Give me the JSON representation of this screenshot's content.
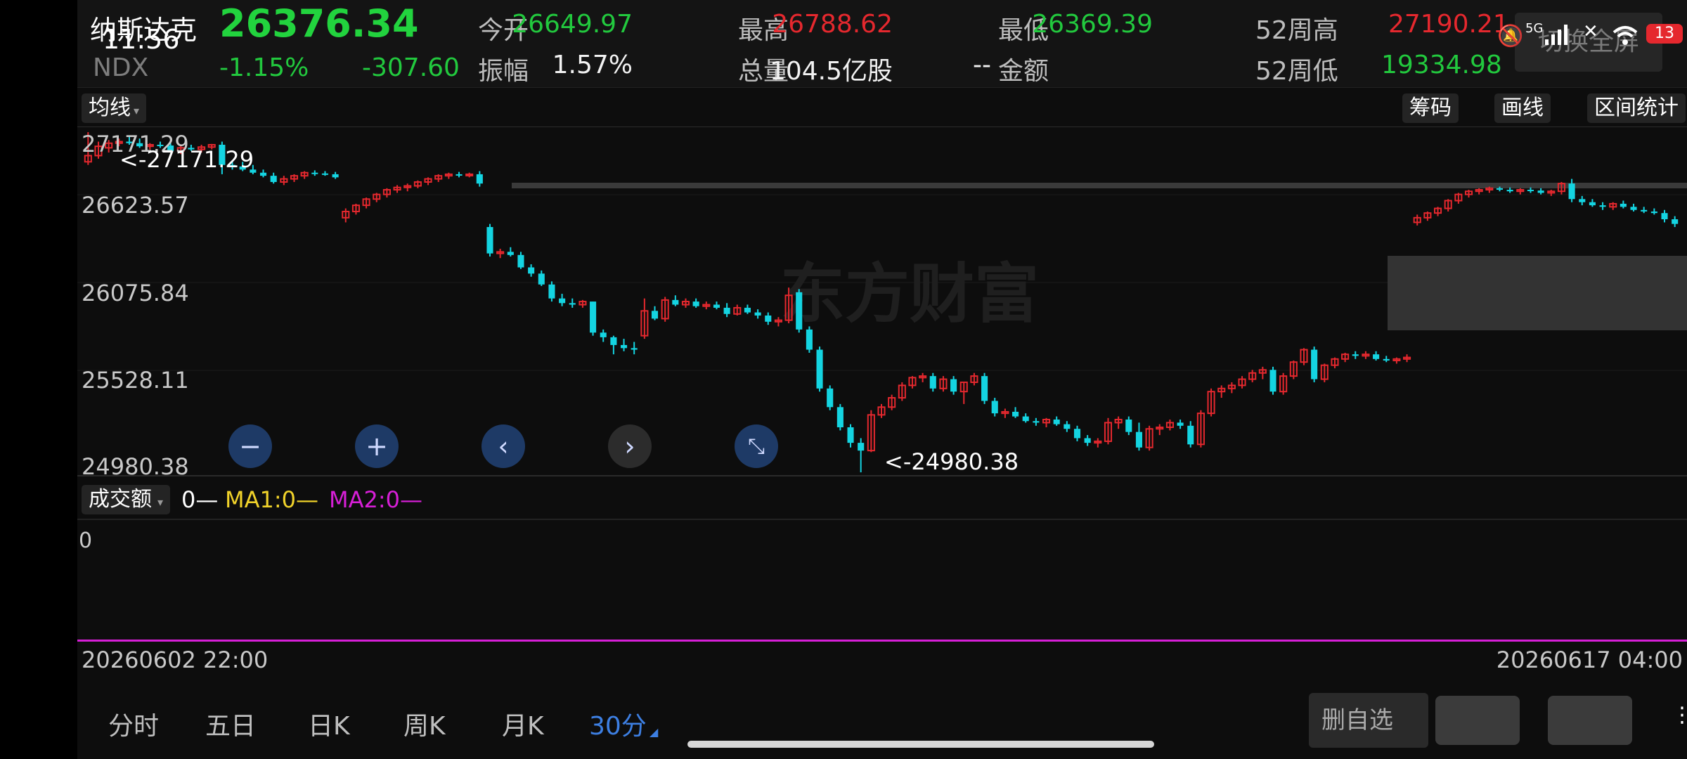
{
  "status": {
    "time": "11:56",
    "net": "5G",
    "battery": "13"
  },
  "quote": {
    "name": "纳斯达克",
    "code": "NDX",
    "price": "26376.34",
    "change_pct": "-1.15%",
    "change": "-307.60",
    "fields": [
      {
        "label": "今开",
        "value": "26649.97",
        "color": "green"
      },
      {
        "label": "最高",
        "value": "26788.62",
        "color": "red"
      },
      {
        "label": "最低",
        "value": "26369.39",
        "color": "green"
      },
      {
        "label": "52周高",
        "value": "27190.21",
        "color": "red"
      },
      {
        "label": "振幅",
        "value": "1.57%",
        "color": "white"
      },
      {
        "label": "总量",
        "value": "104.5亿股",
        "color": "white"
      },
      {
        "label": "金额",
        "value": "--",
        "color": "white"
      },
      {
        "label": "52周低",
        "value": "19334.98",
        "color": "green"
      }
    ],
    "fullscreen_label": "切换全屏"
  },
  "toolbar": {
    "ma_label": "均线",
    "chip_label": "筹码",
    "draw_label": "画线",
    "range_label": "区间统计"
  },
  "price_axis": [
    "27171.29",
    "26623.57",
    "26075.84",
    "25528.11",
    "24980.38"
  ],
  "annotations": {
    "high": "<-27171.29",
    "low": "<-24980.38"
  },
  "watermark": "东方财富",
  "volume": {
    "selector": "成交额",
    "v0": "0—",
    "ma1": "MA1:0—",
    "ma2": "MA2:0—",
    "axis_zero": "0"
  },
  "time_axis": {
    "start": "20260602 22:00",
    "end": "20260617 04:00"
  },
  "tabs": [
    "分时",
    "五日",
    "日K",
    "周K",
    "月K",
    "30分"
  ],
  "active_tab": "30分",
  "delete_label": "删自选",
  "colors": {
    "up": "#e5282e",
    "down": "#14d4e1",
    "ma2": "#d61fd6",
    "ma1": "#f0d22a"
  },
  "chart_data": {
    "type": "candlestick",
    "ylim": [
      24980.38,
      27171.29
    ],
    "x_start": "20260602 22:00",
    "x_end": "20260617 04:00",
    "candles": [
      {
        "o": 26980,
        "h": 27171,
        "l": 26960,
        "c": 27020
      },
      {
        "o": 27020,
        "h": 27110,
        "l": 27000,
        "c": 27080
      },
      {
        "o": 27070,
        "h": 27120,
        "l": 27040,
        "c": 27100
      },
      {
        "o": 27100,
        "h": 27130,
        "l": 27080,
        "c": 27110
      },
      {
        "o": 27110,
        "h": 27140,
        "l": 27090,
        "c": 27100
      },
      {
        "o": 27100,
        "h": 27130,
        "l": 27070,
        "c": 27080
      },
      {
        "o": 27080,
        "h": 27100,
        "l": 27060,
        "c": 27090
      },
      {
        "o": 27090,
        "h": 27110,
        "l": 27070,
        "c": 27085
      },
      {
        "o": 27085,
        "h": 27100,
        "l": 27040,
        "c": 27050
      },
      {
        "o": 27050,
        "h": 27090,
        "l": 27030,
        "c": 27070
      },
      {
        "o": 27070,
        "h": 27090,
        "l": 27050,
        "c": 27060
      },
      {
        "o": 27060,
        "h": 27090,
        "l": 27040,
        "c": 27075
      },
      {
        "o": 27075,
        "h": 27095,
        "l": 27060,
        "c": 27090
      },
      {
        "o": 27090,
        "h": 27110,
        "l": 26900,
        "c": 26960
      },
      {
        "o": 26960,
        "h": 26990,
        "l": 26930,
        "c": 26950
      },
      {
        "o": 26950,
        "h": 26980,
        "l": 26920,
        "c": 26930
      },
      {
        "o": 26930,
        "h": 26960,
        "l": 26900,
        "c": 26910
      },
      {
        "o": 26910,
        "h": 26930,
        "l": 26880,
        "c": 26890
      },
      {
        "o": 26890,
        "h": 26910,
        "l": 26840,
        "c": 26850
      },
      {
        "o": 26850,
        "h": 26890,
        "l": 26830,
        "c": 26870
      },
      {
        "o": 26870,
        "h": 26900,
        "l": 26850,
        "c": 26890
      },
      {
        "o": 26890,
        "h": 26920,
        "l": 26870,
        "c": 26910
      },
      {
        "o": 26910,
        "h": 26925,
        "l": 26890,
        "c": 26905
      },
      {
        "o": 26905,
        "h": 26920,
        "l": 26890,
        "c": 26900
      },
      {
        "o": 26900,
        "h": 26915,
        "l": 26870,
        "c": 26880
      },
      {
        "o": 26620,
        "h": 26680,
        "l": 26590,
        "c": 26660
      },
      {
        "o": 26660,
        "h": 26710,
        "l": 26640,
        "c": 26700
      },
      {
        "o": 26700,
        "h": 26750,
        "l": 26680,
        "c": 26740
      },
      {
        "o": 26740,
        "h": 26780,
        "l": 26720,
        "c": 26770
      },
      {
        "o": 26770,
        "h": 26810,
        "l": 26750,
        "c": 26800
      },
      {
        "o": 26800,
        "h": 26830,
        "l": 26780,
        "c": 26815
      },
      {
        "o": 26815,
        "h": 26840,
        "l": 26790,
        "c": 26825
      },
      {
        "o": 26825,
        "h": 26860,
        "l": 26810,
        "c": 26850
      },
      {
        "o": 26850,
        "h": 26880,
        "l": 26830,
        "c": 26870
      },
      {
        "o": 26870,
        "h": 26900,
        "l": 26850,
        "c": 26890
      },
      {
        "o": 26890,
        "h": 26910,
        "l": 26870,
        "c": 26900
      },
      {
        "o": 26900,
        "h": 26915,
        "l": 26880,
        "c": 26895
      },
      {
        "o": 26895,
        "h": 26910,
        "l": 26880,
        "c": 26900
      },
      {
        "o": 26900,
        "h": 26920,
        "l": 26820,
        "c": 26840
      },
      {
        "o": 26560,
        "h": 26580,
        "l": 26370,
        "c": 26390
      },
      {
        "o": 26390,
        "h": 26420,
        "l": 26360,
        "c": 26400
      },
      {
        "o": 26400,
        "h": 26430,
        "l": 26370,
        "c": 26380
      },
      {
        "o": 26380,
        "h": 26400,
        "l": 26290,
        "c": 26300
      },
      {
        "o": 26300,
        "h": 26320,
        "l": 26240,
        "c": 26260
      },
      {
        "o": 26260,
        "h": 26280,
        "l": 26180,
        "c": 26190
      },
      {
        "o": 26190,
        "h": 26210,
        "l": 26080,
        "c": 26100
      },
      {
        "o": 26100,
        "h": 26130,
        "l": 26050,
        "c": 26070
      },
      {
        "o": 26070,
        "h": 26100,
        "l": 26040,
        "c": 26060
      },
      {
        "o": 26060,
        "h": 26090,
        "l": 26040,
        "c": 26080
      },
      {
        "o": 26080,
        "h": 25860,
        "l": 25860,
        "c": 25880
      },
      {
        "o": 25880,
        "h": 25900,
        "l": 25820,
        "c": 25850
      },
      {
        "o": 25850,
        "h": 25860,
        "l": 25740,
        "c": 25800
      },
      {
        "o": 25800,
        "h": 25840,
        "l": 25760,
        "c": 25780
      },
      {
        "o": 25780,
        "h": 25820,
        "l": 25740,
        "c": 25770
      },
      {
        "o": 25860,
        "h": 26100,
        "l": 25840,
        "c": 26020
      },
      {
        "o": 26020,
        "h": 26050,
        "l": 25960,
        "c": 25970
      },
      {
        "o": 25970,
        "h": 26110,
        "l": 25950,
        "c": 26090
      },
      {
        "o": 26090,
        "h": 26120,
        "l": 26050,
        "c": 26060
      },
      {
        "o": 26060,
        "h": 26100,
        "l": 26040,
        "c": 26080
      },
      {
        "o": 26080,
        "h": 26100,
        "l": 26040,
        "c": 26050
      },
      {
        "o": 26050,
        "h": 26080,
        "l": 26030,
        "c": 26060
      },
      {
        "o": 26060,
        "h": 26080,
        "l": 26030,
        "c": 26040
      },
      {
        "o": 26040,
        "h": 26070,
        "l": 25980,
        "c": 26000
      },
      {
        "o": 26000,
        "h": 26060,
        "l": 25990,
        "c": 26040
      },
      {
        "o": 26040,
        "h": 26060,
        "l": 26000,
        "c": 26010
      },
      {
        "o": 26010,
        "h": 26030,
        "l": 25970,
        "c": 25990
      },
      {
        "o": 25990,
        "h": 26010,
        "l": 25930,
        "c": 25950
      },
      {
        "o": 25950,
        "h": 25980,
        "l": 25920,
        "c": 25960
      },
      {
        "o": 25960,
        "h": 26170,
        "l": 25940,
        "c": 26120
      },
      {
        "o": 26140,
        "h": 26160,
        "l": 25880,
        "c": 25900
      },
      {
        "o": 25900,
        "h": 25920,
        "l": 25750,
        "c": 25770
      },
      {
        "o": 25770,
        "h": 25790,
        "l": 25500,
        "c": 25520
      },
      {
        "o": 25520,
        "h": 25540,
        "l": 25380,
        "c": 25400
      },
      {
        "o": 25400,
        "h": 25420,
        "l": 25250,
        "c": 25270
      },
      {
        "o": 25270,
        "h": 25290,
        "l": 25140,
        "c": 25170
      },
      {
        "o": 25170,
        "h": 25200,
        "l": 24980,
        "c": 25120
      },
      {
        "o": 25120,
        "h": 25380,
        "l": 25110,
        "c": 25350
      },
      {
        "o": 25350,
        "h": 25420,
        "l": 25330,
        "c": 25400
      },
      {
        "o": 25400,
        "h": 25480,
        "l": 25380,
        "c": 25460
      },
      {
        "o": 25460,
        "h": 25560,
        "l": 25440,
        "c": 25540
      },
      {
        "o": 25540,
        "h": 25600,
        "l": 25520,
        "c": 25590
      },
      {
        "o": 25590,
        "h": 25620,
        "l": 25560,
        "c": 25600
      },
      {
        "o": 25600,
        "h": 25620,
        "l": 25500,
        "c": 25520
      },
      {
        "o": 25520,
        "h": 25600,
        "l": 25500,
        "c": 25580
      },
      {
        "o": 25580,
        "h": 25600,
        "l": 25480,
        "c": 25500
      },
      {
        "o": 25500,
        "h": 25530,
        "l": 25420,
        "c": 25560
      },
      {
        "o": 25560,
        "h": 25620,
        "l": 25540,
        "c": 25600
      },
      {
        "o": 25600,
        "h": 25620,
        "l": 25420,
        "c": 25440
      },
      {
        "o": 25440,
        "h": 25460,
        "l": 25340,
        "c": 25360
      },
      {
        "o": 25360,
        "h": 25390,
        "l": 25330,
        "c": 25370
      },
      {
        "o": 25370,
        "h": 25400,
        "l": 25330,
        "c": 25340
      },
      {
        "o": 25340,
        "h": 25360,
        "l": 25300,
        "c": 25310
      },
      {
        "o": 25310,
        "h": 25330,
        "l": 25280,
        "c": 25300
      },
      {
        "o": 25300,
        "h": 25330,
        "l": 25270,
        "c": 25320
      },
      {
        "o": 25320,
        "h": 25340,
        "l": 25280,
        "c": 25290
      },
      {
        "o": 25290,
        "h": 25310,
        "l": 25240,
        "c": 25260
      },
      {
        "o": 25260,
        "h": 25280,
        "l": 25180,
        "c": 25200
      },
      {
        "o": 25200,
        "h": 25220,
        "l": 25150,
        "c": 25170
      },
      {
        "o": 25170,
        "h": 25200,
        "l": 25140,
        "c": 25180
      },
      {
        "o": 25180,
        "h": 25330,
        "l": 25160,
        "c": 25300
      },
      {
        "o": 25300,
        "h": 25340,
        "l": 25260,
        "c": 25320
      },
      {
        "o": 25320,
        "h": 25340,
        "l": 25220,
        "c": 25240
      },
      {
        "o": 25240,
        "h": 25300,
        "l": 25120,
        "c": 25140
      },
      {
        "o": 25140,
        "h": 25280,
        "l": 25120,
        "c": 25260
      },
      {
        "o": 25260,
        "h": 25290,
        "l": 25220,
        "c": 25270
      },
      {
        "o": 25270,
        "h": 25320,
        "l": 25250,
        "c": 25300
      },
      {
        "o": 25300,
        "h": 25320,
        "l": 25260,
        "c": 25280
      },
      {
        "o": 25280,
        "h": 25310,
        "l": 25140,
        "c": 25160
      },
      {
        "o": 25160,
        "h": 25380,
        "l": 25140,
        "c": 25360
      },
      {
        "o": 25360,
        "h": 25520,
        "l": 25340,
        "c": 25500
      },
      {
        "o": 25500,
        "h": 25540,
        "l": 25460,
        "c": 25520
      },
      {
        "o": 25520,
        "h": 25560,
        "l": 25490,
        "c": 25540
      },
      {
        "o": 25540,
        "h": 25600,
        "l": 25520,
        "c": 25580
      },
      {
        "o": 25580,
        "h": 25640,
        "l": 25560,
        "c": 25620
      },
      {
        "o": 25620,
        "h": 25660,
        "l": 25580,
        "c": 25640
      },
      {
        "o": 25640,
        "h": 25660,
        "l": 25480,
        "c": 25500
      },
      {
        "o": 25500,
        "h": 25620,
        "l": 25480,
        "c": 25600
      },
      {
        "o": 25600,
        "h": 25700,
        "l": 25580,
        "c": 25690
      },
      {
        "o": 25690,
        "h": 25780,
        "l": 25670,
        "c": 25770
      },
      {
        "o": 25770,
        "h": 25790,
        "l": 25560,
        "c": 25580
      },
      {
        "o": 25580,
        "h": 25680,
        "l": 25560,
        "c": 25670
      },
      {
        "o": 25670,
        "h": 25720,
        "l": 25650,
        "c": 25710
      },
      {
        "o": 25710,
        "h": 25750,
        "l": 25690,
        "c": 25740
      },
      {
        "o": 25740,
        "h": 25760,
        "l": 25710,
        "c": 25730
      },
      {
        "o": 25730,
        "h": 25760,
        "l": 25710,
        "c": 25740
      },
      {
        "o": 25740,
        "h": 25760,
        "l": 25700,
        "c": 25710
      },
      {
        "o": 25710,
        "h": 25730,
        "l": 25690,
        "c": 25700
      },
      {
        "o": 25700,
        "h": 25720,
        "l": 25680,
        "c": 25710
      },
      {
        "o": 25710,
        "h": 25740,
        "l": 25690,
        "c": 25720
      },
      {
        "o": 26590,
        "h": 26640,
        "l": 26570,
        "c": 26620
      },
      {
        "o": 26620,
        "h": 26660,
        "l": 26600,
        "c": 26650
      },
      {
        "o": 26650,
        "h": 26690,
        "l": 26630,
        "c": 26680
      },
      {
        "o": 26680,
        "h": 26740,
        "l": 26660,
        "c": 26730
      },
      {
        "o": 26730,
        "h": 26780,
        "l": 26710,
        "c": 26770
      },
      {
        "o": 26770,
        "h": 26800,
        "l": 26750,
        "c": 26790
      },
      {
        "o": 26790,
        "h": 26810,
        "l": 26770,
        "c": 26800
      },
      {
        "o": 26800,
        "h": 26820,
        "l": 26780,
        "c": 26810
      },
      {
        "o": 26810,
        "h": 26820,
        "l": 26790,
        "c": 26800
      },
      {
        "o": 26800,
        "h": 26815,
        "l": 26780,
        "c": 26790
      },
      {
        "o": 26790,
        "h": 26810,
        "l": 26770,
        "c": 26800
      },
      {
        "o": 26800,
        "h": 26815,
        "l": 26780,
        "c": 26795
      },
      {
        "o": 26795,
        "h": 26810,
        "l": 26770,
        "c": 26780
      },
      {
        "o": 26780,
        "h": 26800,
        "l": 26760,
        "c": 26790
      },
      {
        "o": 26790,
        "h": 26850,
        "l": 26770,
        "c": 26840
      },
      {
        "o": 26840,
        "h": 26870,
        "l": 26720,
        "c": 26740
      },
      {
        "o": 26740,
        "h": 26760,
        "l": 26700,
        "c": 26720
      },
      {
        "o": 26720,
        "h": 26740,
        "l": 26690,
        "c": 26700
      },
      {
        "o": 26700,
        "h": 26720,
        "l": 26670,
        "c": 26690
      },
      {
        "o": 26690,
        "h": 26720,
        "l": 26670,
        "c": 26710
      },
      {
        "o": 26710,
        "h": 26730,
        "l": 26680,
        "c": 26690
      },
      {
        "o": 26690,
        "h": 26710,
        "l": 26660,
        "c": 26670
      },
      {
        "o": 26670,
        "h": 26690,
        "l": 26650,
        "c": 26660
      },
      {
        "o": 26660,
        "h": 26680,
        "l": 26640,
        "c": 26650
      },
      {
        "o": 26650,
        "h": 26670,
        "l": 26590,
        "c": 26610
      },
      {
        "o": 26610,
        "h": 26630,
        "l": 26560,
        "c": 26580
      }
    ]
  }
}
